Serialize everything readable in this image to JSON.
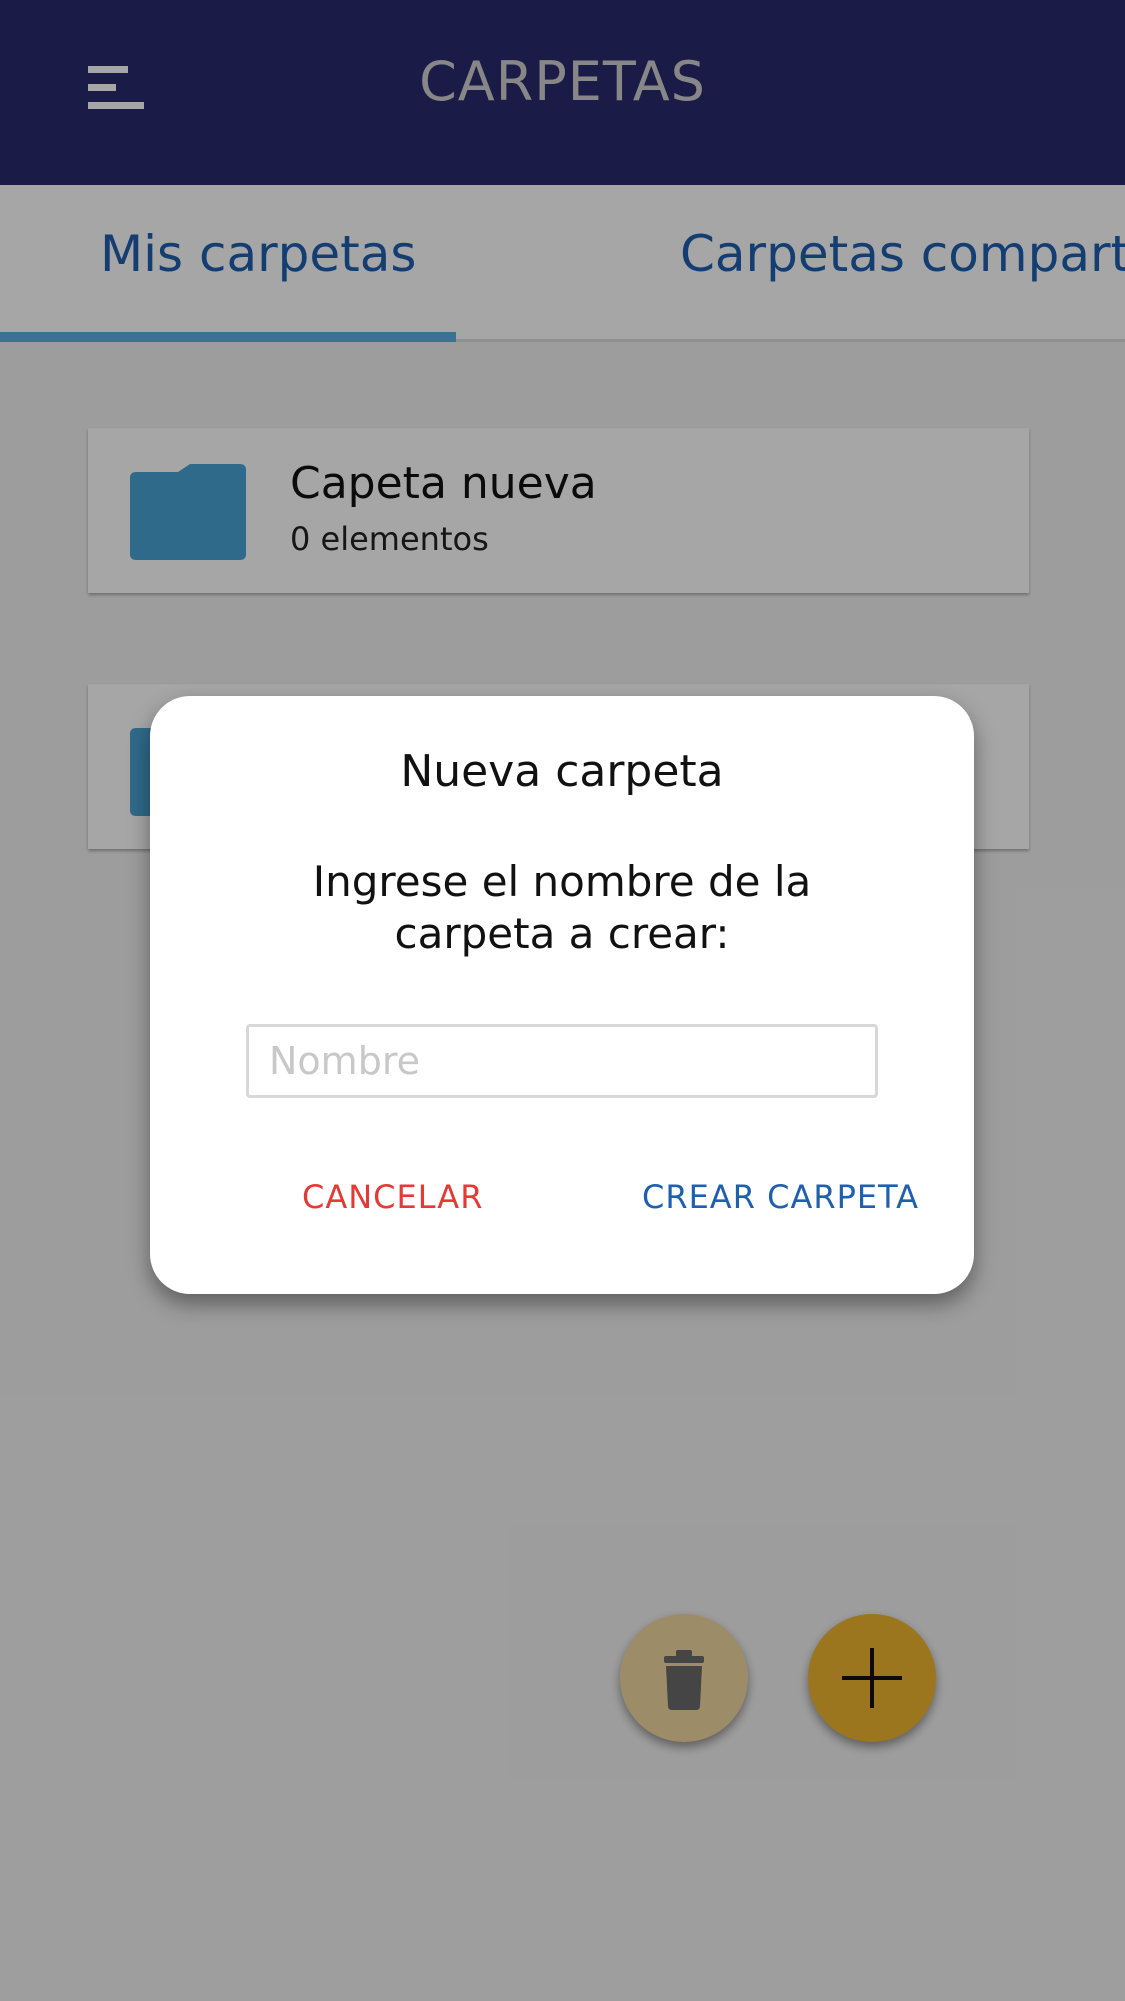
{
  "header": {
    "title": "CARPETAS",
    "background": "#2a2a6e",
    "menu_icon": "hamburger-menu-icon"
  },
  "tabs": [
    {
      "label": "Mis carpetas",
      "active": true
    },
    {
      "label": "Carpetas comparti",
      "active": false
    }
  ],
  "colors": {
    "accent": "#5bb0dc",
    "link": "#1f5fb0",
    "folder": "#4aa3d4",
    "danger": "#e53935",
    "fab_add": "#f0b52f",
    "fab_delete": "#f2d7a0"
  },
  "folders": [
    {
      "name": "Capeta nueva",
      "count": "0 elementos",
      "icon": "folder-icon"
    },
    {
      "icon": "folder-icon"
    }
  ],
  "fabs": {
    "delete_icon": "trash-icon",
    "add_icon": "plus-icon"
  },
  "dialog": {
    "title": "Nueva carpeta",
    "message": "Ingrese el nombre de la carpeta a crear:",
    "input_placeholder": "Nombre",
    "input_value": "",
    "cancel_label": "CANCELAR",
    "create_label": "CREAR CARPETA"
  }
}
